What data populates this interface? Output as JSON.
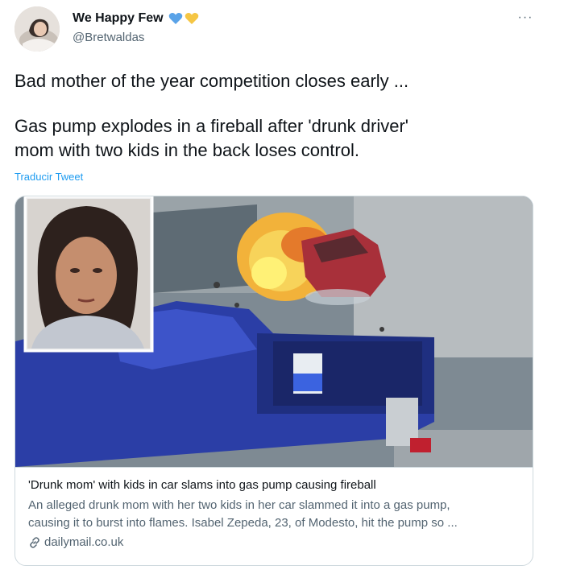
{
  "author": {
    "display_name": "We Happy Few",
    "handle": "@Bretwaldas",
    "heart_icons": [
      "blue-heart-icon",
      "yellow-heart-icon"
    ],
    "heart_colors": [
      "#5aa3e8",
      "#f5c644"
    ]
  },
  "more_menu_icon": "more-dots-icon",
  "tweet": {
    "line1": "Bad mother of the year competition closes early ...",
    "line2": "Gas pump explodes in a fireball after 'drunk driver'",
    "line3": "mom with two kids in the back loses control.",
    "translate_label": "Traducir Tweet"
  },
  "card": {
    "image_icon": "news-photo",
    "title": "'Drunk mom' with kids in car slams into gas pump causing fireball",
    "description_line1": "An alleged drunk mom with her two kids in her car slammed it into a gas pump,",
    "description_line2": "causing it to burst into flames. Isabel Zepeda, 23, of Modesto, hit the pump so ...",
    "domain": "dailymail.co.uk",
    "domain_icon": "link-icon"
  },
  "colors": {
    "accent": "#1d9bf0",
    "text_primary": "#0f1419",
    "text_secondary": "#536471",
    "border": "#cfd9de"
  }
}
